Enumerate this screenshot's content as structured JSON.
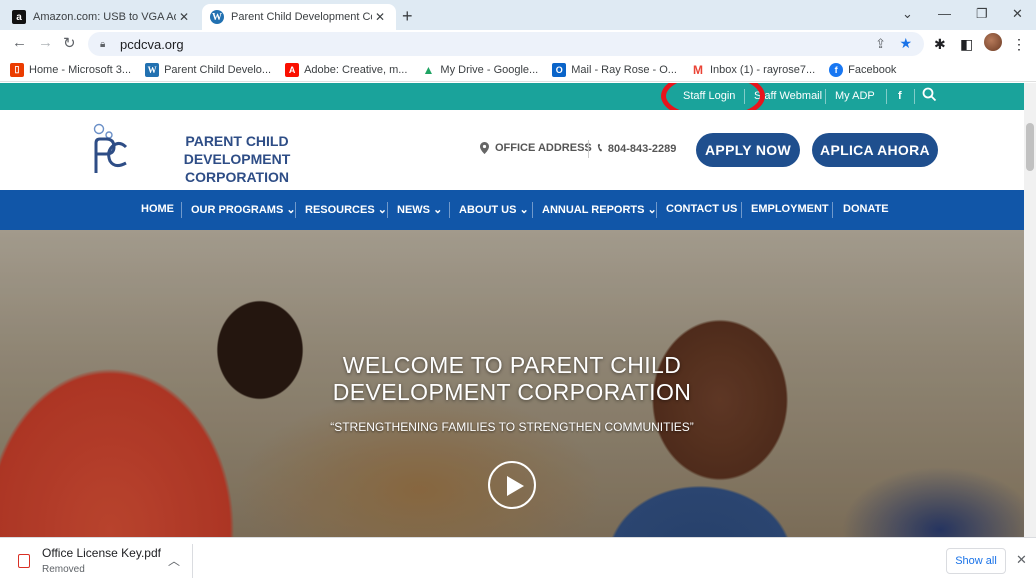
{
  "browser": {
    "tabs": [
      {
        "title": "Amazon.com: USB to VGA Adapt",
        "active": false
      },
      {
        "title": "Parent Child Development Corpo",
        "active": true
      }
    ],
    "new_tab": "+",
    "url": "pcdcva.org",
    "window_controls": {
      "minimize": "—",
      "restore": "❐",
      "close": "✕"
    },
    "bookmarks": [
      {
        "label": "Home - Microsoft 3...",
        "icon": "office-icon"
      },
      {
        "label": "Parent Child Develo...",
        "icon": "wordpress-icon"
      },
      {
        "label": "Adobe: Creative, m...",
        "icon": "adobe-icon"
      },
      {
        "label": "My Drive - Google...",
        "icon": "drive-icon"
      },
      {
        "label": "Mail - Ray Rose - O...",
        "icon": "outlook-icon"
      },
      {
        "label": "Inbox (1) - rayrose7...",
        "icon": "gmail-icon"
      },
      {
        "label": "Facebook",
        "icon": "facebook-icon"
      }
    ]
  },
  "site": {
    "topbar": {
      "links": [
        "Staff Login",
        "Staff Webmail",
        "My ADP"
      ],
      "social": "f",
      "accent": "#1aa39b",
      "highlight_color": "#e8141c"
    },
    "header": {
      "logo_line1": "PARENT CHILD DEVELOPMENT",
      "logo_line2": "CORPORATION",
      "office": "OFFICE ADDRESS",
      "phone": "804-843-2289",
      "apply_now": "APPLY NOW",
      "aplica_ahora": "APLICA AHORA",
      "brand_color": "#1f4f8e"
    },
    "nav": [
      {
        "label": "HOME",
        "dropdown": false
      },
      {
        "label": "OUR PROGRAMS",
        "dropdown": true
      },
      {
        "label": "RESOURCES",
        "dropdown": true
      },
      {
        "label": "NEWS",
        "dropdown": true
      },
      {
        "label": "ABOUT US",
        "dropdown": true
      },
      {
        "label": "ANNUAL REPORTS",
        "dropdown": true
      },
      {
        "label": "CONTACT US",
        "dropdown": false
      },
      {
        "label": "EMPLOYMENT",
        "dropdown": false
      },
      {
        "label": "DONATE",
        "dropdown": false
      }
    ],
    "hero": {
      "title_line1": "WELCOME TO PARENT CHILD",
      "title_line2": "DEVELOPMENT CORPORATION",
      "subtitle": "“STRENGTHENING FAMILIES TO STRENGTHEN COMMUNITIES”"
    }
  },
  "download": {
    "filename": "Office License Key.pdf",
    "status": "Removed",
    "show_all": "Show all"
  }
}
